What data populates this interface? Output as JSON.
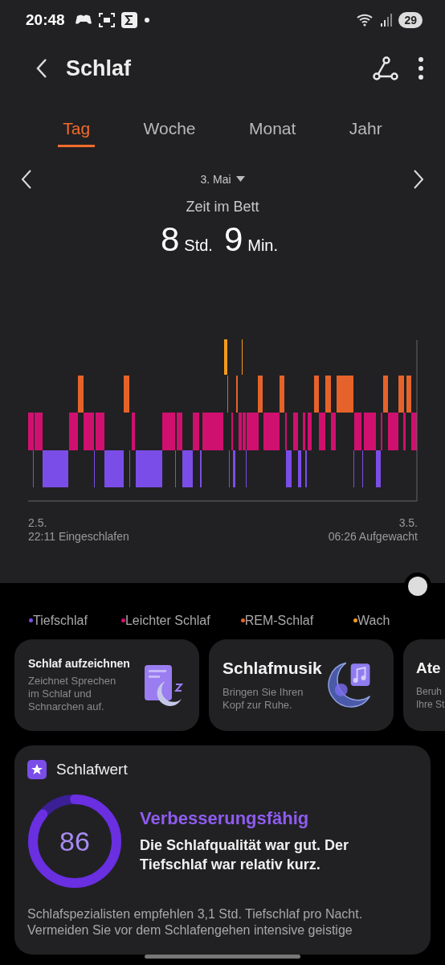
{
  "status_bar": {
    "time": "20:48",
    "battery": "29"
  },
  "header": {
    "title": "Schlaf"
  },
  "tabs": [
    {
      "label": "Tag",
      "selected": true
    },
    {
      "label": "Woche",
      "selected": false
    },
    {
      "label": "Monat",
      "selected": false
    },
    {
      "label": "Jahr",
      "selected": false
    }
  ],
  "date_nav": {
    "date": "3. Mai"
  },
  "summary": {
    "label": "Zeit im Bett",
    "hours": "8",
    "hours_unit": "Std.",
    "minutes": "9",
    "minutes_unit": "Min."
  },
  "hypnogram": {
    "start_date": "2.5.",
    "start_label": "22:11 Eingeschlafen",
    "end_date": "3.5.",
    "end_label": "06:26 Aufgewacht"
  },
  "legend": [
    {
      "label": "Tiefschlaf",
      "color": "#7b4de8"
    },
    {
      "label": "Leichter Schlaf",
      "color": "#d0106f"
    },
    {
      "label": "REM-Schlaf",
      "color": "#e5632a"
    },
    {
      "label": "Wach",
      "color": "#f39a1c"
    }
  ],
  "cards": [
    {
      "kind": "record",
      "title": "Schlaf aufzeichnen",
      "lines": [
        "Zeichnet Sprechen",
        "im Schlaf und",
        "Schnarchen auf."
      ]
    },
    {
      "kind": "music",
      "title": "Schlafmusik",
      "lines": [
        "Bringen Sie Ihren",
        "Kopf zur Ruhe."
      ]
    },
    {
      "kind": "plain",
      "title": "Ate",
      "lines": [
        "Beruh",
        "Ihre St"
      ]
    }
  ],
  "score_card": {
    "title": "Schlafwert",
    "score": "86",
    "level": 0.86,
    "rating": "Verbesserungsfähig",
    "summary": "Die Schlafqualität war gut. Der Tiefschlaf war relativ kurz.",
    "advice": "Schlafspezialisten empfehlen 3,1 Std. Tiefschlaf pro Nacht. Vermeiden Sie vor dem Schlafengehen intensive geistige"
  }
}
